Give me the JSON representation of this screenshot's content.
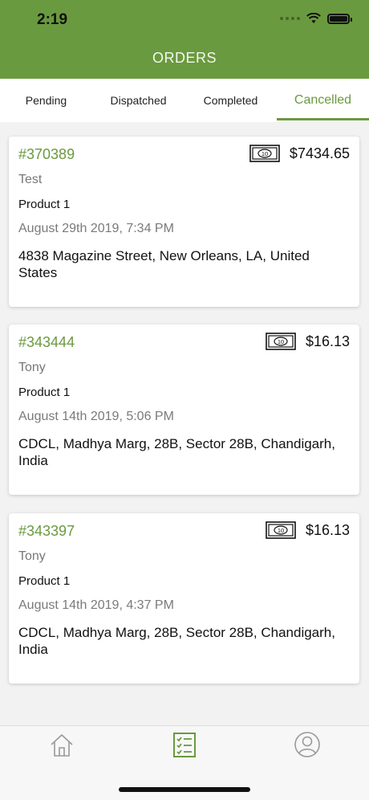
{
  "status_bar": {
    "time": "2:19"
  },
  "header": {
    "title": "ORDERS"
  },
  "tabs": [
    {
      "label": "Pending",
      "active": false
    },
    {
      "label": "Dispatched",
      "active": false
    },
    {
      "label": "Completed",
      "active": false
    },
    {
      "label": "Cancelled",
      "active": true
    }
  ],
  "orders": [
    {
      "id": "#370389",
      "amount": "$7434.65",
      "customer": "Test",
      "product": "Product 1",
      "date": "August 29th 2019, 7:34 PM",
      "address": "4838 Magazine Street, New Orleans, LA, United States"
    },
    {
      "id": "#343444",
      "amount": "$16.13",
      "customer": "Tony",
      "product": "Product 1",
      "date": "August 14th 2019, 5:06 PM",
      "address": "CDCL, Madhya Marg, 28B, Sector 28B, Chandigarh, India"
    },
    {
      "id": "#343397",
      "amount": "$16.13",
      "customer": "Tony",
      "product": "Product 1",
      "date": "August 14th 2019, 4:37 PM",
      "address": "CDCL, Madhya Marg, 28B, Sector 28B, Chandigarh, India"
    }
  ],
  "bottom_nav": {
    "items": [
      {
        "icon": "home-icon"
      },
      {
        "icon": "orders-list-icon",
        "active": true
      },
      {
        "icon": "profile-icon"
      }
    ]
  },
  "colors": {
    "accent": "#6a9a3f",
    "background": "#f2f2f2"
  },
  "icons": {
    "cash": "cash-icon",
    "cash_label": "10"
  }
}
